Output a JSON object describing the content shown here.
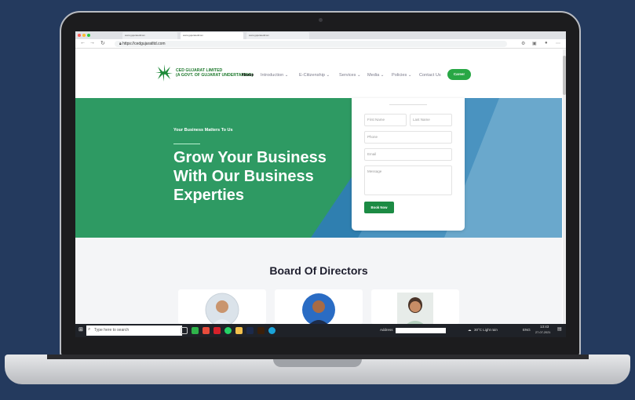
{
  "browser": {
    "tabs": [
      {
        "label": "www.gujaratedlcom"
      },
      {
        "label": "www.gujaratedlcom"
      },
      {
        "label": "www.gujaratedlcom"
      }
    ],
    "active_tab_label": "www.gujaratedlcom",
    "url": "https://cedgujaratltd.com"
  },
  "site": {
    "logo_line1": "CED GUJARAT LIMITED",
    "logo_line2": "(A GOVT. OF GUJARAT UNDERTAKING)",
    "nav": [
      {
        "label": "Home"
      },
      {
        "label": "Introduction ⌄"
      },
      {
        "label": "E-Citizenship ⌄"
      },
      {
        "label": "Services ⌄"
      },
      {
        "label": "Media ⌄"
      },
      {
        "label": "Policies ⌄"
      },
      {
        "label": "Contact Us"
      }
    ],
    "career_label": "Career"
  },
  "hero": {
    "tagline": "Your Business Matters To Us",
    "title": "Grow Your Business With Our Business Experties"
  },
  "form": {
    "first_name_placeholder": "First Name",
    "last_name_placeholder": "Last Name",
    "phone_placeholder": "Phone",
    "email_placeholder": "Email",
    "message_placeholder": "Message",
    "submit_label": "Book Now"
  },
  "board": {
    "title": "Board Of Directors"
  },
  "taskbar": {
    "search_placeholder": "Type here to search",
    "address_label": "Address",
    "weather": "30°C Light rain",
    "lang": "ENG",
    "time": "13:43",
    "date": "27-07-2021"
  },
  "colors": {
    "brand_green": "#28a745",
    "hero_green": "#2e9a63",
    "hero_blue": "#2f7fb0",
    "background": "#243a5e"
  }
}
